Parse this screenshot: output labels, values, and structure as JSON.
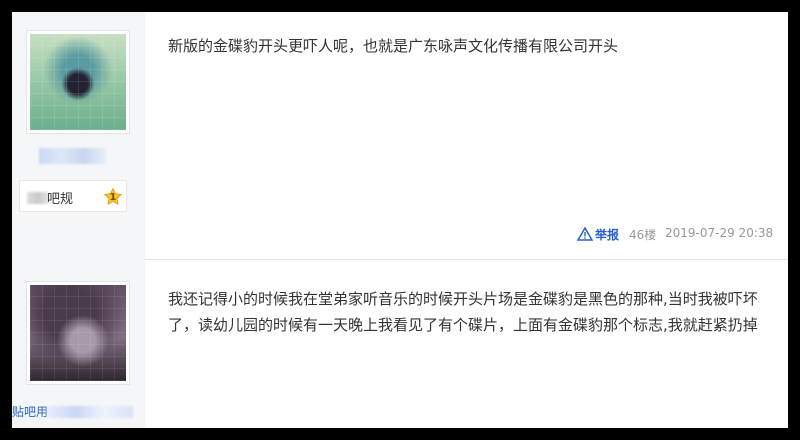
{
  "posts": [
    {
      "author": {
        "title": "吧规",
        "level": "1"
      },
      "content": "新版的金碟豹开头更吓人呢，也就是广东咏声文化传播有限公司开头",
      "actions": {
        "report_label": "举报",
        "floor": "46楼",
        "timestamp": "2019-07-29 20:38"
      }
    },
    {
      "author": {
        "visible_prefix": "贴吧用"
      },
      "content": "我还记得小的时候我在堂弟家听音乐的时候开头片场是金碟豹是黑色的那种,当时我被吓坏了，读幼儿园的时候有一天晚上我看见了有个碟片，上面有金碟豹那个标志,我就赶紧扔掉"
    }
  ],
  "colors": {
    "link": "#2a61c8",
    "meta": "#999999",
    "text": "#333333",
    "sidebar": "#f5f6f8"
  }
}
